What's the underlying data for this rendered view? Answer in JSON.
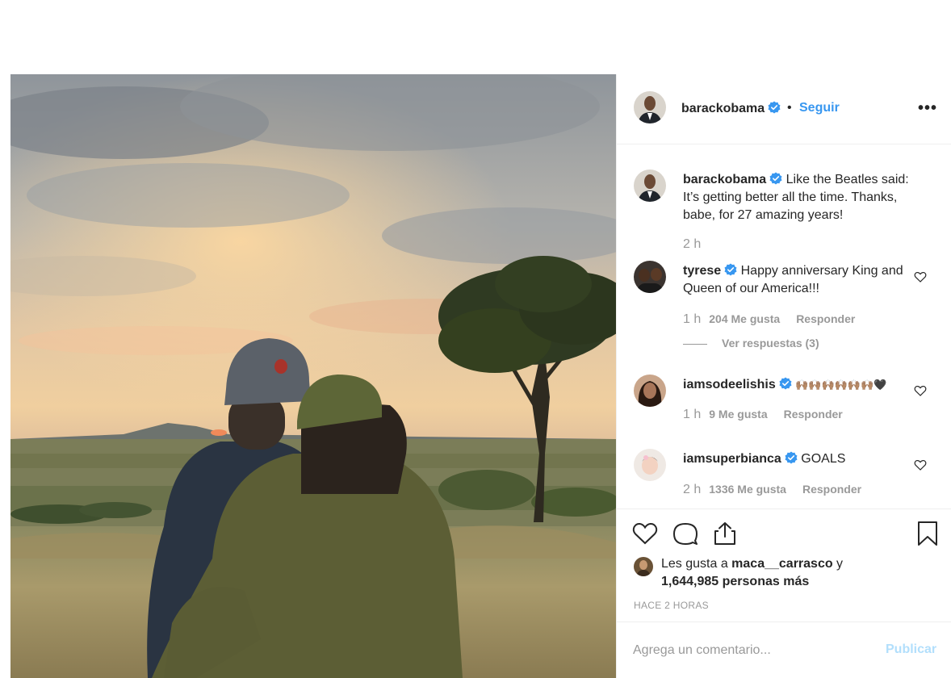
{
  "post": {
    "author": "barackobama",
    "follow_label": "Seguir",
    "separator": "•",
    "more_label": "•••",
    "caption": {
      "user": "barackobama",
      "text": "Like the Beatles said: It’s getting better all the time. Thanks, babe, for 27 amazing years!",
      "time": "2 h"
    }
  },
  "comments": [
    {
      "user": "tyrese",
      "text": "Happy anniversary King and Queen of our America!!!",
      "time": "1 h",
      "likes": "204 Me gusta",
      "reply": "Responder",
      "view_replies": "Ver respuestas (3)"
    },
    {
      "user": "iamsodeelishis",
      "text": "🙌🏽🙌🏽🙌🏽🙌🏽🙌🏽🙌🏽🖤",
      "time": "1 h",
      "likes": "9 Me gusta",
      "reply": "Responder"
    },
    {
      "user": "iamsuperbianca",
      "text": "GOALS",
      "time": "2 h",
      "likes": "1336 Me gusta",
      "reply": "Responder"
    }
  ],
  "likes_summary": {
    "prefix": "Les gusta a ",
    "user": "maca__carrasco",
    "connector": " y",
    "count": "1,644,985 personas más"
  },
  "timestamp": "HACE 2 HORAS",
  "add_comment": {
    "placeholder": "Agrega un comentario...",
    "post_label": "Publicar"
  },
  "colors": {
    "link": "#3897f0",
    "verified": "#3897f0",
    "muted": "#999999",
    "post_disabled": "#b2dffc"
  },
  "icons": [
    "verified-badge-icon",
    "heart-icon",
    "comment-icon",
    "share-icon",
    "bookmark-icon",
    "more-options-icon"
  ]
}
